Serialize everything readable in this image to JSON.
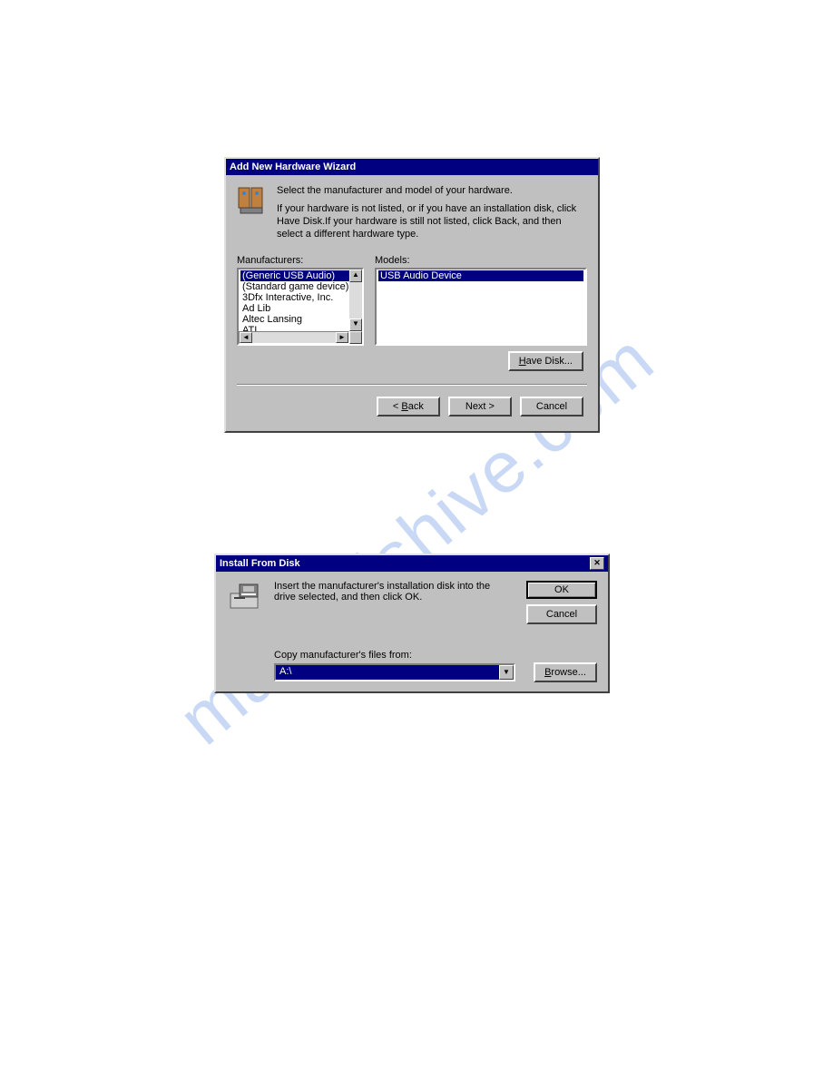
{
  "watermark": "manualshive.com",
  "dialog1": {
    "title": "Add New Hardware Wizard",
    "intro1": "Select the manufacturer and model of your hardware.",
    "intro2": "If your hardware is not listed, or if you have an installation disk, click Have Disk.If your hardware is still not listed, click Back, and then select a different hardware type.",
    "manufacturers_label": "Manufacturers:",
    "models_label": "Models:",
    "manufacturers": [
      "(Generic USB Audio)",
      "(Standard game device)",
      "3Dfx Interactive, Inc.",
      "Ad Lib",
      "Altec Lansing",
      "ATI"
    ],
    "models": [
      "USB Audio Device"
    ],
    "have_disk_btn": "Have Disk...",
    "back_btn": "< Back",
    "next_btn": "Next >",
    "cancel_btn": "Cancel"
  },
  "dialog2": {
    "title": "Install From Disk",
    "instruction": "Insert the manufacturer's installation disk into the drive selected, and then click OK.",
    "ok_btn": "OK",
    "cancel_btn": "Cancel",
    "copy_label": "Copy manufacturer's files from:",
    "path_value": "A:\\",
    "browse_btn": "Browse..."
  },
  "accel": {
    "have_disk": "H",
    "back": "B",
    "browse": "B"
  }
}
